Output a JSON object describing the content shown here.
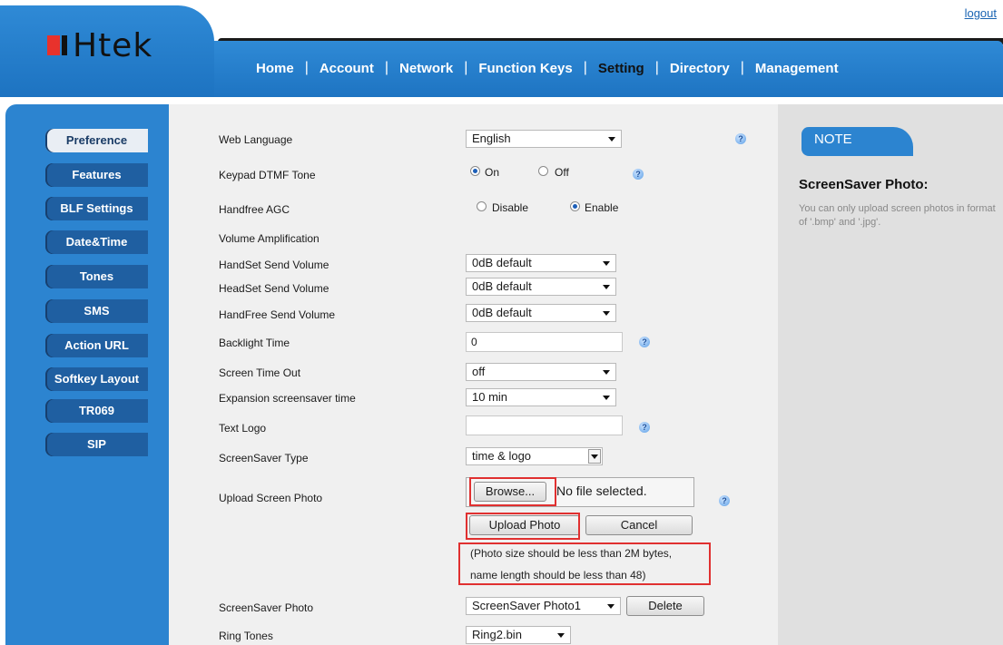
{
  "header": {
    "logout": "logout",
    "logo_text": "Htek",
    "logo_colors": {
      "red": "#e8322c",
      "blue": "#1e6fbf"
    },
    "nav": [
      {
        "label": "Home",
        "active": false
      },
      {
        "label": "Account",
        "active": false
      },
      {
        "label": "Network",
        "active": false
      },
      {
        "label": "Function Keys",
        "active": false
      },
      {
        "label": "Setting",
        "active": true
      },
      {
        "label": "Directory",
        "active": false
      },
      {
        "label": "Management",
        "active": false
      }
    ]
  },
  "sidebar": {
    "items": [
      {
        "label": "Preference",
        "active": true
      },
      {
        "label": "Features",
        "active": false
      },
      {
        "label": "BLF Settings",
        "active": false
      },
      {
        "label": "Date&Time",
        "active": false
      },
      {
        "label": "Tones",
        "active": false
      },
      {
        "label": "SMS",
        "active": false
      },
      {
        "label": "Action URL",
        "active": false
      },
      {
        "label": "Softkey Layout",
        "active": false
      },
      {
        "label": "TR069",
        "active": false
      },
      {
        "label": "SIP",
        "active": false
      }
    ]
  },
  "form": {
    "web_language": {
      "label": "Web Language",
      "value": "English"
    },
    "keypad_dtmf": {
      "label": "Keypad DTMF Tone",
      "options": [
        "On",
        "Off"
      ],
      "selected": "On"
    },
    "handfree_agc": {
      "label": "Handfree AGC",
      "options": [
        "Disable",
        "Enable"
      ],
      "selected": "Enable"
    },
    "volume_amplification": {
      "label": "Volume Amplification"
    },
    "handset_send": {
      "label": "HandSet Send Volume",
      "value": "0dB default"
    },
    "headset_send": {
      "label": "HeadSet Send Volume",
      "value": "0dB default"
    },
    "handfree_send": {
      "label": "HandFree Send Volume",
      "value": "0dB default"
    },
    "backlight_time": {
      "label": "Backlight Time",
      "value": "0"
    },
    "screen_time_out": {
      "label": "Screen Time Out",
      "value": "off"
    },
    "expansion_screensaver": {
      "label": "Expansion screensaver time",
      "value": "10 min"
    },
    "text_logo": {
      "label": "Text Logo",
      "value": ""
    },
    "screensaver_type": {
      "label": "ScreenSaver Type",
      "value": "time & logo"
    },
    "upload_screen_photo": {
      "label": "Upload Screen Photo",
      "browse": "Browse...",
      "file_status": "No file selected.",
      "upload": "Upload Photo",
      "cancel": "Cancel",
      "note_line1": "(Photo size should be less than 2M bytes,",
      "note_line2": "name length should be less than 48)"
    },
    "screensaver_photo": {
      "label": "ScreenSaver Photo",
      "value": "ScreenSaver Photo1",
      "delete": "Delete"
    },
    "ring_tones": {
      "label": "Ring Tones",
      "value": "Ring2.bin"
    }
  },
  "note": {
    "tab": "NOTE",
    "title": "ScreenSaver Photo:",
    "text": "You can only upload screen photos in format of '.bmp' and '.jpg'."
  },
  "colors": {
    "header_blue": "#2c84d0",
    "highlight_red": "#e03030"
  }
}
